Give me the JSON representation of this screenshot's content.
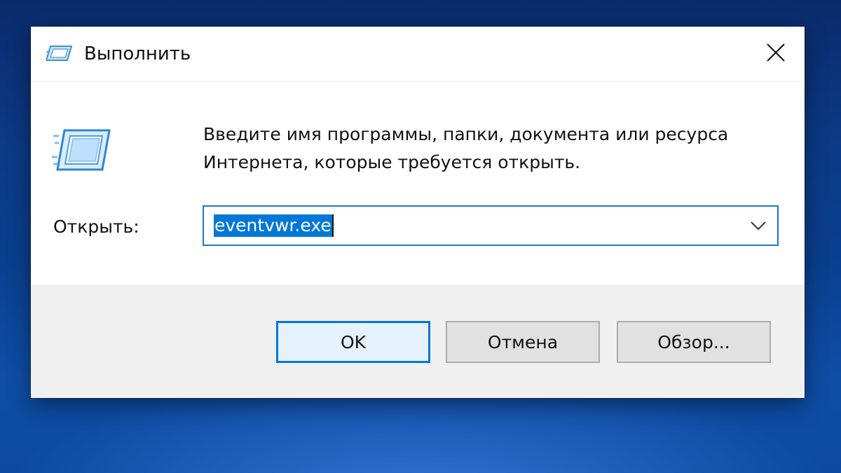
{
  "window": {
    "title": "Выполнить",
    "title_icon": "run-icon",
    "close_icon": "close-icon"
  },
  "main": {
    "icon": "run-icon",
    "description_line1": "Введите имя программы, папки, документа или ресурса",
    "description_line2": "Интернета, которые требуется открыть.",
    "open_label": "Открыть:",
    "open_value": "eventvwr.exe",
    "dropdown_icon": "chevron-down-icon"
  },
  "buttons": {
    "ok": "OK",
    "cancel": "Отмена",
    "browse": "Обзор..."
  },
  "colors": {
    "accent": "#0078d7",
    "selection": "#0078d7",
    "footer_bg": "#f0f0f0"
  }
}
